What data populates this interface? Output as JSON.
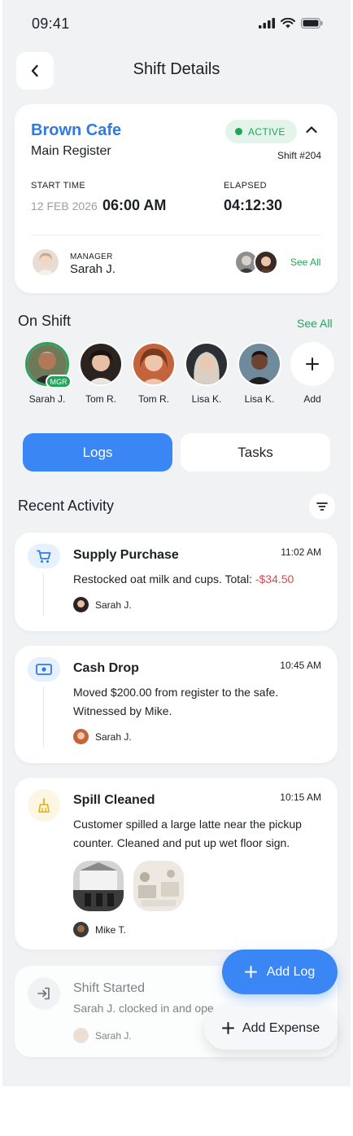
{
  "status_bar": {
    "time": "09:41"
  },
  "header": {
    "title": "Shift Details"
  },
  "shift": {
    "cafe": "Brown Cafe",
    "register": "Main Register",
    "status": "ACTIVE",
    "shift_number": "Shift #204",
    "start_label": "START TIME",
    "start_date": "12 FEB 2026",
    "start_time": "06:00 AM",
    "elapsed_label": "ELAPSED",
    "elapsed": "04:12:30",
    "manager_label": "MANAGER",
    "manager_name": "Sarah J.",
    "see_all": "See All"
  },
  "on_shift": {
    "title": "On Shift",
    "see_all": "See All",
    "badge": "MGR",
    "members": [
      {
        "name": "Sarah J."
      },
      {
        "name": "Tom R."
      },
      {
        "name": "Tom R."
      },
      {
        "name": "Lisa K."
      },
      {
        "name": "Lisa K."
      }
    ],
    "add_label": "Add"
  },
  "tabs": {
    "logs": "Logs",
    "tasks": "Tasks",
    "active": "Logs"
  },
  "activity": {
    "title": "Recent Activity",
    "items": [
      {
        "icon": "cart-icon",
        "title": "Supply Purchase",
        "time": "11:02 AM",
        "desc": "Restocked oat milk and cups. Total: ",
        "amount": "-$34.50",
        "user": "Sarah J."
      },
      {
        "icon": "cash-icon",
        "title": "Cash Drop",
        "time": "10:45 AM",
        "desc": "Moved $200.00 from register to the safe. Witnessed by Mike.",
        "user": "Sarah J."
      },
      {
        "icon": "broom-icon",
        "title": "Spill Cleaned",
        "time": "10:15 AM",
        "desc": "Customer spilled a large latte near the pickup counter. Cleaned and put up wet floor sign.",
        "user": "Mike T."
      },
      {
        "icon": "login-icon",
        "title": "Shift Started",
        "time": "",
        "desc": "Sarah J. clocked in and ope",
        "user": "Sarah J."
      }
    ]
  },
  "fab": {
    "add_log": "Add Log",
    "add_expense": "Add Expense"
  },
  "colors": {
    "accent": "#3a86f4",
    "brand_text": "#2f7be6",
    "success": "#22a55b",
    "danger": "#e0474c",
    "background": "#f1f2f4"
  }
}
